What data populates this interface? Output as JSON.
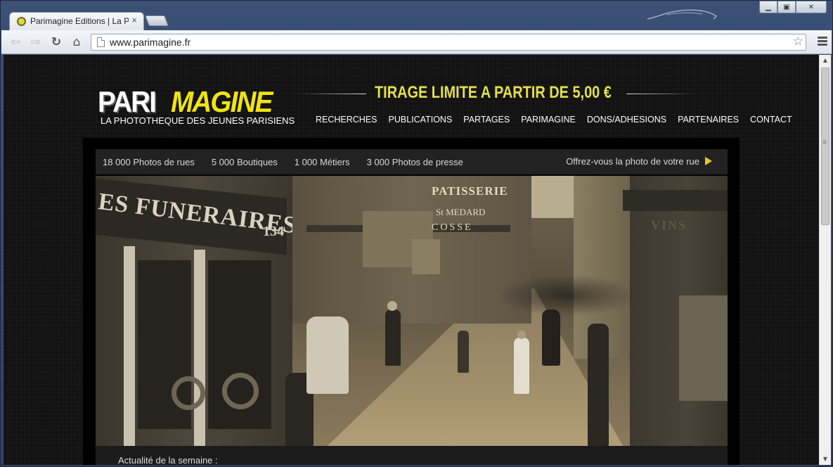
{
  "browser": {
    "tab_title": "Parimagine Editions | La P",
    "tab_close": "×",
    "url": "www.parimagine.fr",
    "window_buttons": {
      "minimize": "▁",
      "maximize": "▣",
      "close": "✕"
    },
    "nav": {
      "back": "⇦",
      "forward": "⇨",
      "reload": "↻",
      "home": "⌂"
    },
    "star": "☆"
  },
  "site": {
    "logo_pari": "PARI",
    "logo_magine": "MAGINE",
    "logo_subtitle": "LA PHOTOTHEQUE DES JEUNES PARISIENS",
    "promo": "TIRAGE LIMITE A PARTIR DE 5,00 €",
    "nav": [
      "RECHERCHES",
      "PUBLICATIONS",
      "PARTAGES",
      "PARIMAGINE",
      "DONS/ADHESIONS",
      "PARTENAIRES",
      "CONTACT"
    ],
    "stats": [
      "18 000 Photos de rues",
      "5 000 Boutiques",
      "1 000 Métiers",
      "3 000 Photos de presse"
    ],
    "offer": "Offrez-vous la photo de votre rue",
    "photo_sign_funeraires": "ES FUNERAIRES",
    "photo_sign_number": "134",
    "photo_sign_patisserie": "PATISSERIE",
    "photo_sign_medard": "St MEDARD",
    "photo_sign_cosse": "COSSE",
    "photo_sign_vins": "VINS",
    "caption": "Actualité de la semaine :"
  },
  "colors": {
    "accent_yellow": "#f1e40f",
    "promo_yellow": "#e3e04a",
    "arrow": "#e5c528",
    "page_bg": "#121212"
  }
}
